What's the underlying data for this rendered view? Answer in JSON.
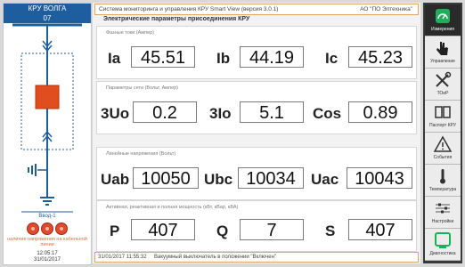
{
  "left_panel": {
    "title": "КРУ ВОЛГА",
    "cell_number": "07",
    "input_label": "Ввод-1",
    "indicator_caption": "наличие напряжения на кабельной линии",
    "clock_time": "12:05:17",
    "clock_date": "31/01/2017"
  },
  "header": {
    "app_title": "Система мониторинга и управления КРУ Smart View (версия 3.0.1)",
    "company": "АО \"ПО Элтехника\""
  },
  "page_title": "Электрические параметры присоединения КРУ",
  "groups": {
    "currents": {
      "label": "Фазные токи (Ампер)",
      "items": [
        {
          "name": "Ia",
          "value": "45.51"
        },
        {
          "name": "Ib",
          "value": "44.19"
        },
        {
          "name": "Ic",
          "value": "45.23"
        }
      ]
    },
    "network": {
      "label": "Параметры сети (Вольт, Ампер)",
      "items": [
        {
          "name": "3Uo",
          "value": "0.2"
        },
        {
          "name": "3Io",
          "value": "5.1"
        },
        {
          "name": "Cos",
          "value": "0.89"
        }
      ]
    },
    "voltages": {
      "label": "Линейные напряжения (Вольт)",
      "items": [
        {
          "name": "Uab",
          "value": "10050"
        },
        {
          "name": "Ubc",
          "value": "10034"
        },
        {
          "name": "Uac",
          "value": "10043"
        }
      ]
    },
    "power": {
      "label": "Активная, реактивная и полная мощность (кВт, кВар, кВА)",
      "items": [
        {
          "name": "P",
          "value": "407"
        },
        {
          "name": "Q",
          "value": "7"
        },
        {
          "name": "S",
          "value": "407"
        }
      ]
    }
  },
  "status_bar": {
    "timestamp": "31/01/2017 11:55:32",
    "message": "Вакуумный выключатель в положении \"Включен\""
  },
  "menu": [
    {
      "label": "Измерения",
      "icon": "gauge-icon",
      "active": true
    },
    {
      "label": "Управление",
      "icon": "hand-icon",
      "active": false
    },
    {
      "label": "ТОиР",
      "icon": "tools-icon",
      "active": false
    },
    {
      "label": "Паспорт КРУ",
      "icon": "book-icon",
      "active": false
    },
    {
      "label": "События",
      "icon": "warning-icon",
      "active": false
    },
    {
      "label": "Температура",
      "icon": "thermometer-icon",
      "active": false
    },
    {
      "label": "Настройки",
      "icon": "sliders-icon",
      "active": false
    },
    {
      "label": "Диагностика",
      "icon": "monitor-icon",
      "active": false
    }
  ],
  "colors": {
    "accent_blue": "#1f5e9e",
    "breaker_red": "#e04e1f",
    "indicator_red": "#e14a2c",
    "frame_orange": "#e5a560",
    "active_menu_green": "#1fae5a"
  }
}
